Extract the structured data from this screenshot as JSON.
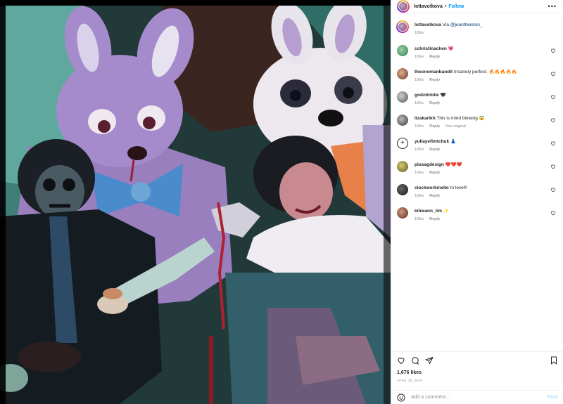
{
  "header": {
    "username": "lottavolkova",
    "separator": "•",
    "follow_label": "Follow",
    "more_label": "•••"
  },
  "caption": {
    "username": "lottavolkova",
    "text": "Via ",
    "mention": "@jeantheresin_",
    "time": "186w"
  },
  "comments": [
    {
      "username": "cchristinachen",
      "text": "💗",
      "time": "186w",
      "reply": "Reply",
      "extra": ""
    },
    {
      "username": "theonemanbandit",
      "text": "Insanely perfect. 🔥🔥🔥🔥🔥",
      "time": "186w",
      "reply": "Reply",
      "extra": ""
    },
    {
      "username": "godzdntdie",
      "text": "🖤",
      "time": "186w",
      "reply": "Reply",
      "extra": ""
    },
    {
      "username": "lizakarikh",
      "text": "This is mind blowing 😱",
      "time": "186w",
      "reply": "Reply",
      "extra": "See original"
    },
    {
      "username": "yuliayefimtchuk",
      "text": "👗",
      "time": "186w",
      "reply": "Reply",
      "extra": ""
    },
    {
      "username": "plusagdesign",
      "text": "❤️❤️❤️",
      "time": "186w",
      "reply": "Reply",
      "extra": ""
    },
    {
      "username": "clockworkmello",
      "text": "In love®",
      "time": "186w",
      "reply": "Reply",
      "extra": ""
    },
    {
      "username": "kihwann_lim",
      "text": "✨",
      "time": "186w",
      "reply": "Reply",
      "extra": ""
    }
  ],
  "actions": {
    "likes": "1,676 likes",
    "date": "APRIL 28, 2019"
  },
  "add_comment": {
    "placeholder": "Add a comment...",
    "post_label": "Post"
  },
  "icons": {
    "like": "heart-icon",
    "comment": "comment-icon",
    "share": "share-icon",
    "save": "bookmark-icon",
    "emoji": "emoji-icon",
    "more": "more-icon"
  },
  "colors": {
    "follow": "#0095f6",
    "meta": "#8e8e8e",
    "post_disabled": "#b2dffc"
  }
}
